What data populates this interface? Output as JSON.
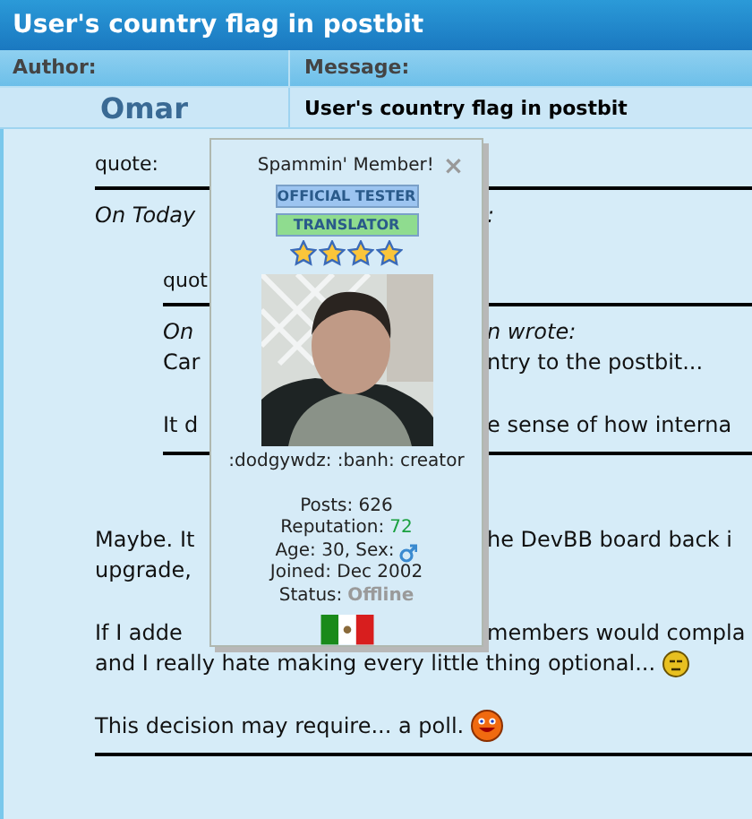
{
  "title": "User's country flag in postbit",
  "columns": [
    "Author:",
    "Message:"
  ],
  "post": {
    "author": "Omar",
    "subject": "User's country flag in postbit",
    "body": [
      {
        "kind": "quote_label",
        "left": "quote:"
      },
      {
        "kind": "rule"
      },
      {
        "kind": "attribution",
        "left": "On Today",
        "right": ":"
      },
      {
        "kind": "quote",
        "children": [
          {
            "kind": "quote_label",
            "left": "quot"
          },
          {
            "kind": "rule"
          },
          {
            "kind": "attribution",
            "left": "On",
            "right": "n wrote:"
          },
          {
            "kind": "paragraph",
            "lines": [
              {
                "left": "Car",
                "right": "ntry to the postbit..."
              }
            ]
          },
          {
            "kind": "paragraph",
            "lines": [
              {
                "left": "It d",
                "right": "e sense of how interna"
              }
            ]
          },
          {
            "kind": "rule"
          }
        ]
      },
      {
        "kind": "paragraph",
        "lines": [
          {
            "left": "Maybe. It",
            "right": "he DevBB board back i"
          },
          {
            "left": "upgrade,"
          }
        ]
      },
      {
        "kind": "paragraph",
        "lines": [
          {
            "left": "If I adde",
            "right": "members would compla"
          },
          {
            "left": "and I really hate making every little thing optional...",
            "kind": "annoyed_smiley"
          }
        ]
      },
      {
        "kind": "paragraph",
        "lines": [
          {
            "left": "This decision may require... a poll.",
            "kind": "happy_smiley"
          }
        ]
      },
      {
        "kind": "rule"
      }
    ]
  },
  "profile_popup": {
    "rank": "Spammin' Member!",
    "close": "×",
    "badges": [
      {
        "label": "OFFICIAL TESTER",
        "color": "#9cc4f0"
      },
      {
        "label": "TRANSLATOR",
        "color": "#8fdc8f"
      }
    ],
    "stars": 4,
    "signature": ":dodgywdz: :banh: creator",
    "posts": "Posts: 626",
    "reputation_label": "Reputation:",
    "reputation": "72",
    "age_sex": "Age: 30, Sex:",
    "joined": "Joined: Dec 2002",
    "status_label": "Status:",
    "status": "Offline",
    "online": false
  }
}
